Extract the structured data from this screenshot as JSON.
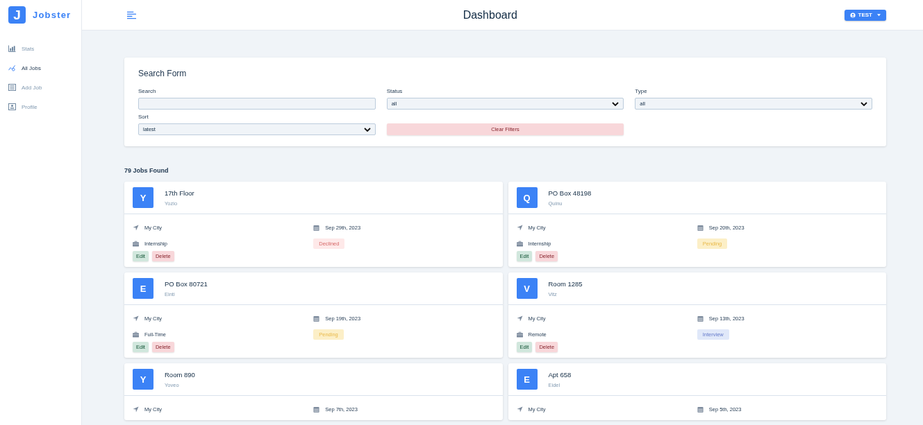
{
  "brand": {
    "logo_letter": "J",
    "name": "Jobster"
  },
  "navbar": {
    "title": "Dashboard",
    "user_button": "TEST"
  },
  "sidebar": {
    "items": [
      {
        "label": "Stats",
        "kind": "stats",
        "selected": false
      },
      {
        "label": "All Jobs",
        "kind": "jobs",
        "selected": true
      },
      {
        "label": "Add Job",
        "kind": "add",
        "selected": false
      },
      {
        "label": "Profile",
        "kind": "profile",
        "selected": false
      }
    ]
  },
  "search_form": {
    "title": "Search Form",
    "fields": [
      {
        "label": "Search",
        "kind": "input"
      },
      {
        "label": "Status",
        "kind": "select",
        "value": "all"
      },
      {
        "label": "Type",
        "kind": "select",
        "value": "all"
      },
      {
        "label": "Sort",
        "kind": "select",
        "value": "latest"
      },
      {
        "label": "Clear Filters",
        "kind": "button"
      }
    ]
  },
  "jobs_found": "79 Jobs Found",
  "jobs": [
    {
      "letter": "Y",
      "position": "17th Floor",
      "company": "Yozio",
      "location": "My City",
      "date": "Sep 29th, 2023",
      "job_type": "Internship",
      "status": {
        "label": "Declined",
        "kind": "declined"
      },
      "actions": [
        "Edit",
        "Delete"
      ]
    },
    {
      "letter": "Q",
      "position": "PO Box 48198",
      "company": "Quinu",
      "location": "My City",
      "date": "Sep 20th, 2023",
      "job_type": "Internship",
      "status": {
        "label": "Pending",
        "kind": "pending"
      },
      "actions": [
        "Edit",
        "Delete"
      ]
    },
    {
      "letter": "E",
      "position": "PO Box 80721",
      "company": "Einti",
      "location": "My City",
      "date": "Sep 19th, 2023",
      "job_type": "Full-Time",
      "status": {
        "label": "Pending",
        "kind": "pending"
      },
      "actions": [
        "Edit",
        "Delete"
      ]
    },
    {
      "letter": "V",
      "position": "Room 1285",
      "company": "Vitz",
      "location": "My City",
      "date": "Sep 13th, 2023",
      "job_type": "Remote",
      "status": {
        "label": "Interview",
        "kind": "interview"
      },
      "actions": [
        "Edit",
        "Delete"
      ]
    },
    {
      "letter": "Y",
      "position": "Room 890",
      "company": "Yoveo",
      "location": "My City",
      "date": "Sep 7th, 2023"
    },
    {
      "letter": "E",
      "position": "Apt 658",
      "company": "Eidel",
      "location": "My City",
      "date": "Sep 5th, 2023"
    }
  ]
}
